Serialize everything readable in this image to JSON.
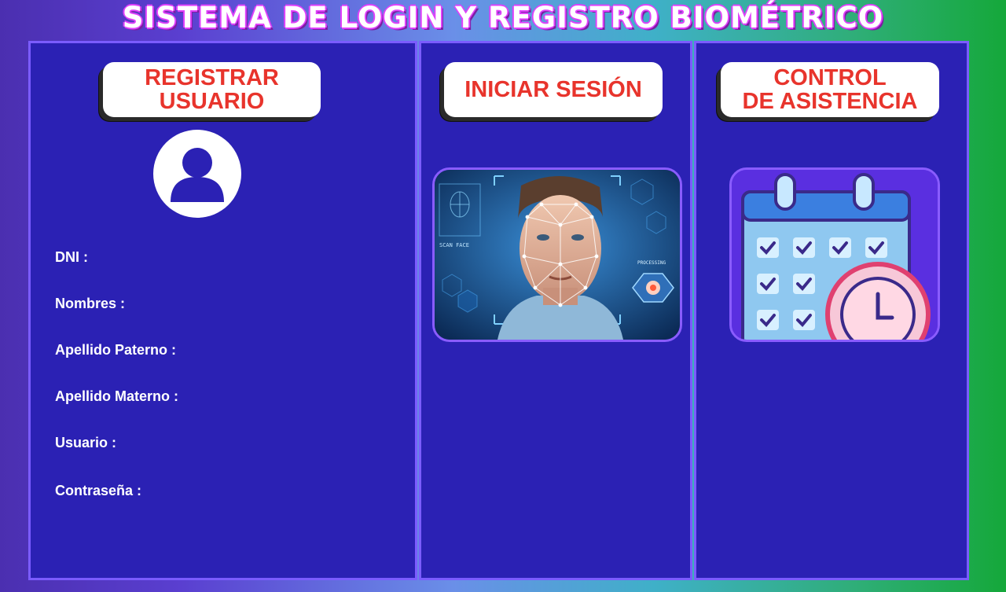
{
  "app": {
    "title": "SISTEMA DE LOGIN Y REGISTRO BIOMÉTRICO"
  },
  "register": {
    "button_label": "REGISTRAR\nUSUARIO",
    "fields": [
      {
        "label": "DNI :"
      },
      {
        "label": "Nombres :"
      },
      {
        "label": "Apellido Paterno :"
      },
      {
        "label": "Apellido Materno :"
      },
      {
        "label": "Usuario :"
      },
      {
        "label": "Contraseña :"
      }
    ]
  },
  "login": {
    "button_label": "INICIAR SESIÓN",
    "image": {
      "scan_label": "SCAN FACE",
      "processing_label": "PROCESSING"
    }
  },
  "attendance": {
    "button_label": "CONTROL\nDE ASISTENCIA"
  },
  "colors": {
    "panel_bg": "#2b21b4",
    "panel_border": "#7b5cff",
    "button_text": "#e8342c",
    "accent_title_outline": "#e040fb"
  },
  "icons": {
    "avatar": "user-icon",
    "calendar": "calendar-check-icon",
    "clock": "clock-icon"
  }
}
